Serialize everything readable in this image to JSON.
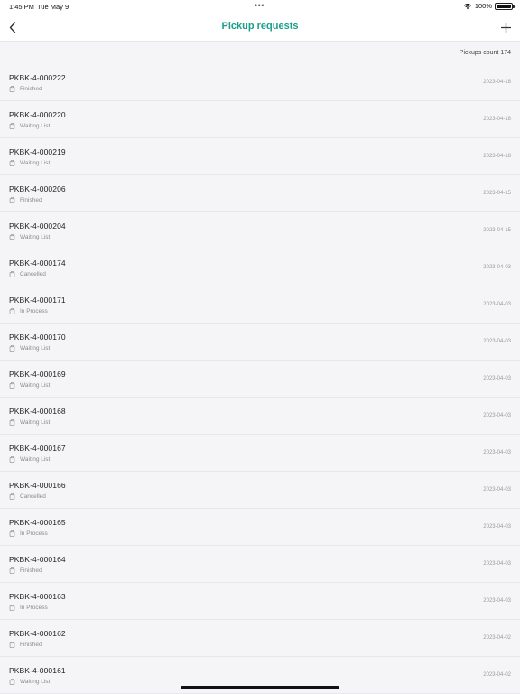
{
  "status_bar": {
    "time": "1:45 PM",
    "date": "Tue May 9",
    "dots": "•••",
    "battery": "100%"
  },
  "nav": {
    "title": "Pickup requests",
    "back_icon": "chevron-left-icon",
    "add_icon": "plus-icon"
  },
  "summary": {
    "count_label": "Pickups count 174"
  },
  "colors": {
    "accent": "#1b9e8a"
  },
  "pickups": [
    {
      "id": "PKBK-4-000222",
      "status": "Finished",
      "date": "2023-04-18"
    },
    {
      "id": "PKBK-4-000220",
      "status": "Waiting List",
      "date": "2023-04-18"
    },
    {
      "id": "PKBK-4-000219",
      "status": "Waiting List",
      "date": "2023-04-18"
    },
    {
      "id": "PKBK-4-000206",
      "status": "Finished",
      "date": "2023-04-15"
    },
    {
      "id": "PKBK-4-000204",
      "status": "Waiting List",
      "date": "2023-04-15"
    },
    {
      "id": "PKBK-4-000174",
      "status": "Cancelled",
      "date": "2023-04-03"
    },
    {
      "id": "PKBK-4-000171",
      "status": "In Process",
      "date": "2023-04-03"
    },
    {
      "id": "PKBK-4-000170",
      "status": "Waiting List",
      "date": "2023-04-03"
    },
    {
      "id": "PKBK-4-000169",
      "status": "Waiting List",
      "date": "2023-04-03"
    },
    {
      "id": "PKBK-4-000168",
      "status": "Waiting List",
      "date": "2023-04-03"
    },
    {
      "id": "PKBK-4-000167",
      "status": "Waiting List",
      "date": "2023-04-03"
    },
    {
      "id": "PKBK-4-000166",
      "status": "Cancelled",
      "date": "2023-04-03"
    },
    {
      "id": "PKBK-4-000165",
      "status": "In Process",
      "date": "2023-04-03"
    },
    {
      "id": "PKBK-4-000164",
      "status": "Finished",
      "date": "2023-04-03"
    },
    {
      "id": "PKBK-4-000163",
      "status": "In Process",
      "date": "2023-04-03"
    },
    {
      "id": "PKBK-4-000162",
      "status": "Finished",
      "date": "2023-04-02"
    },
    {
      "id": "PKBK-4-000161",
      "status": "Waiting List",
      "date": "2023-04-02"
    }
  ]
}
